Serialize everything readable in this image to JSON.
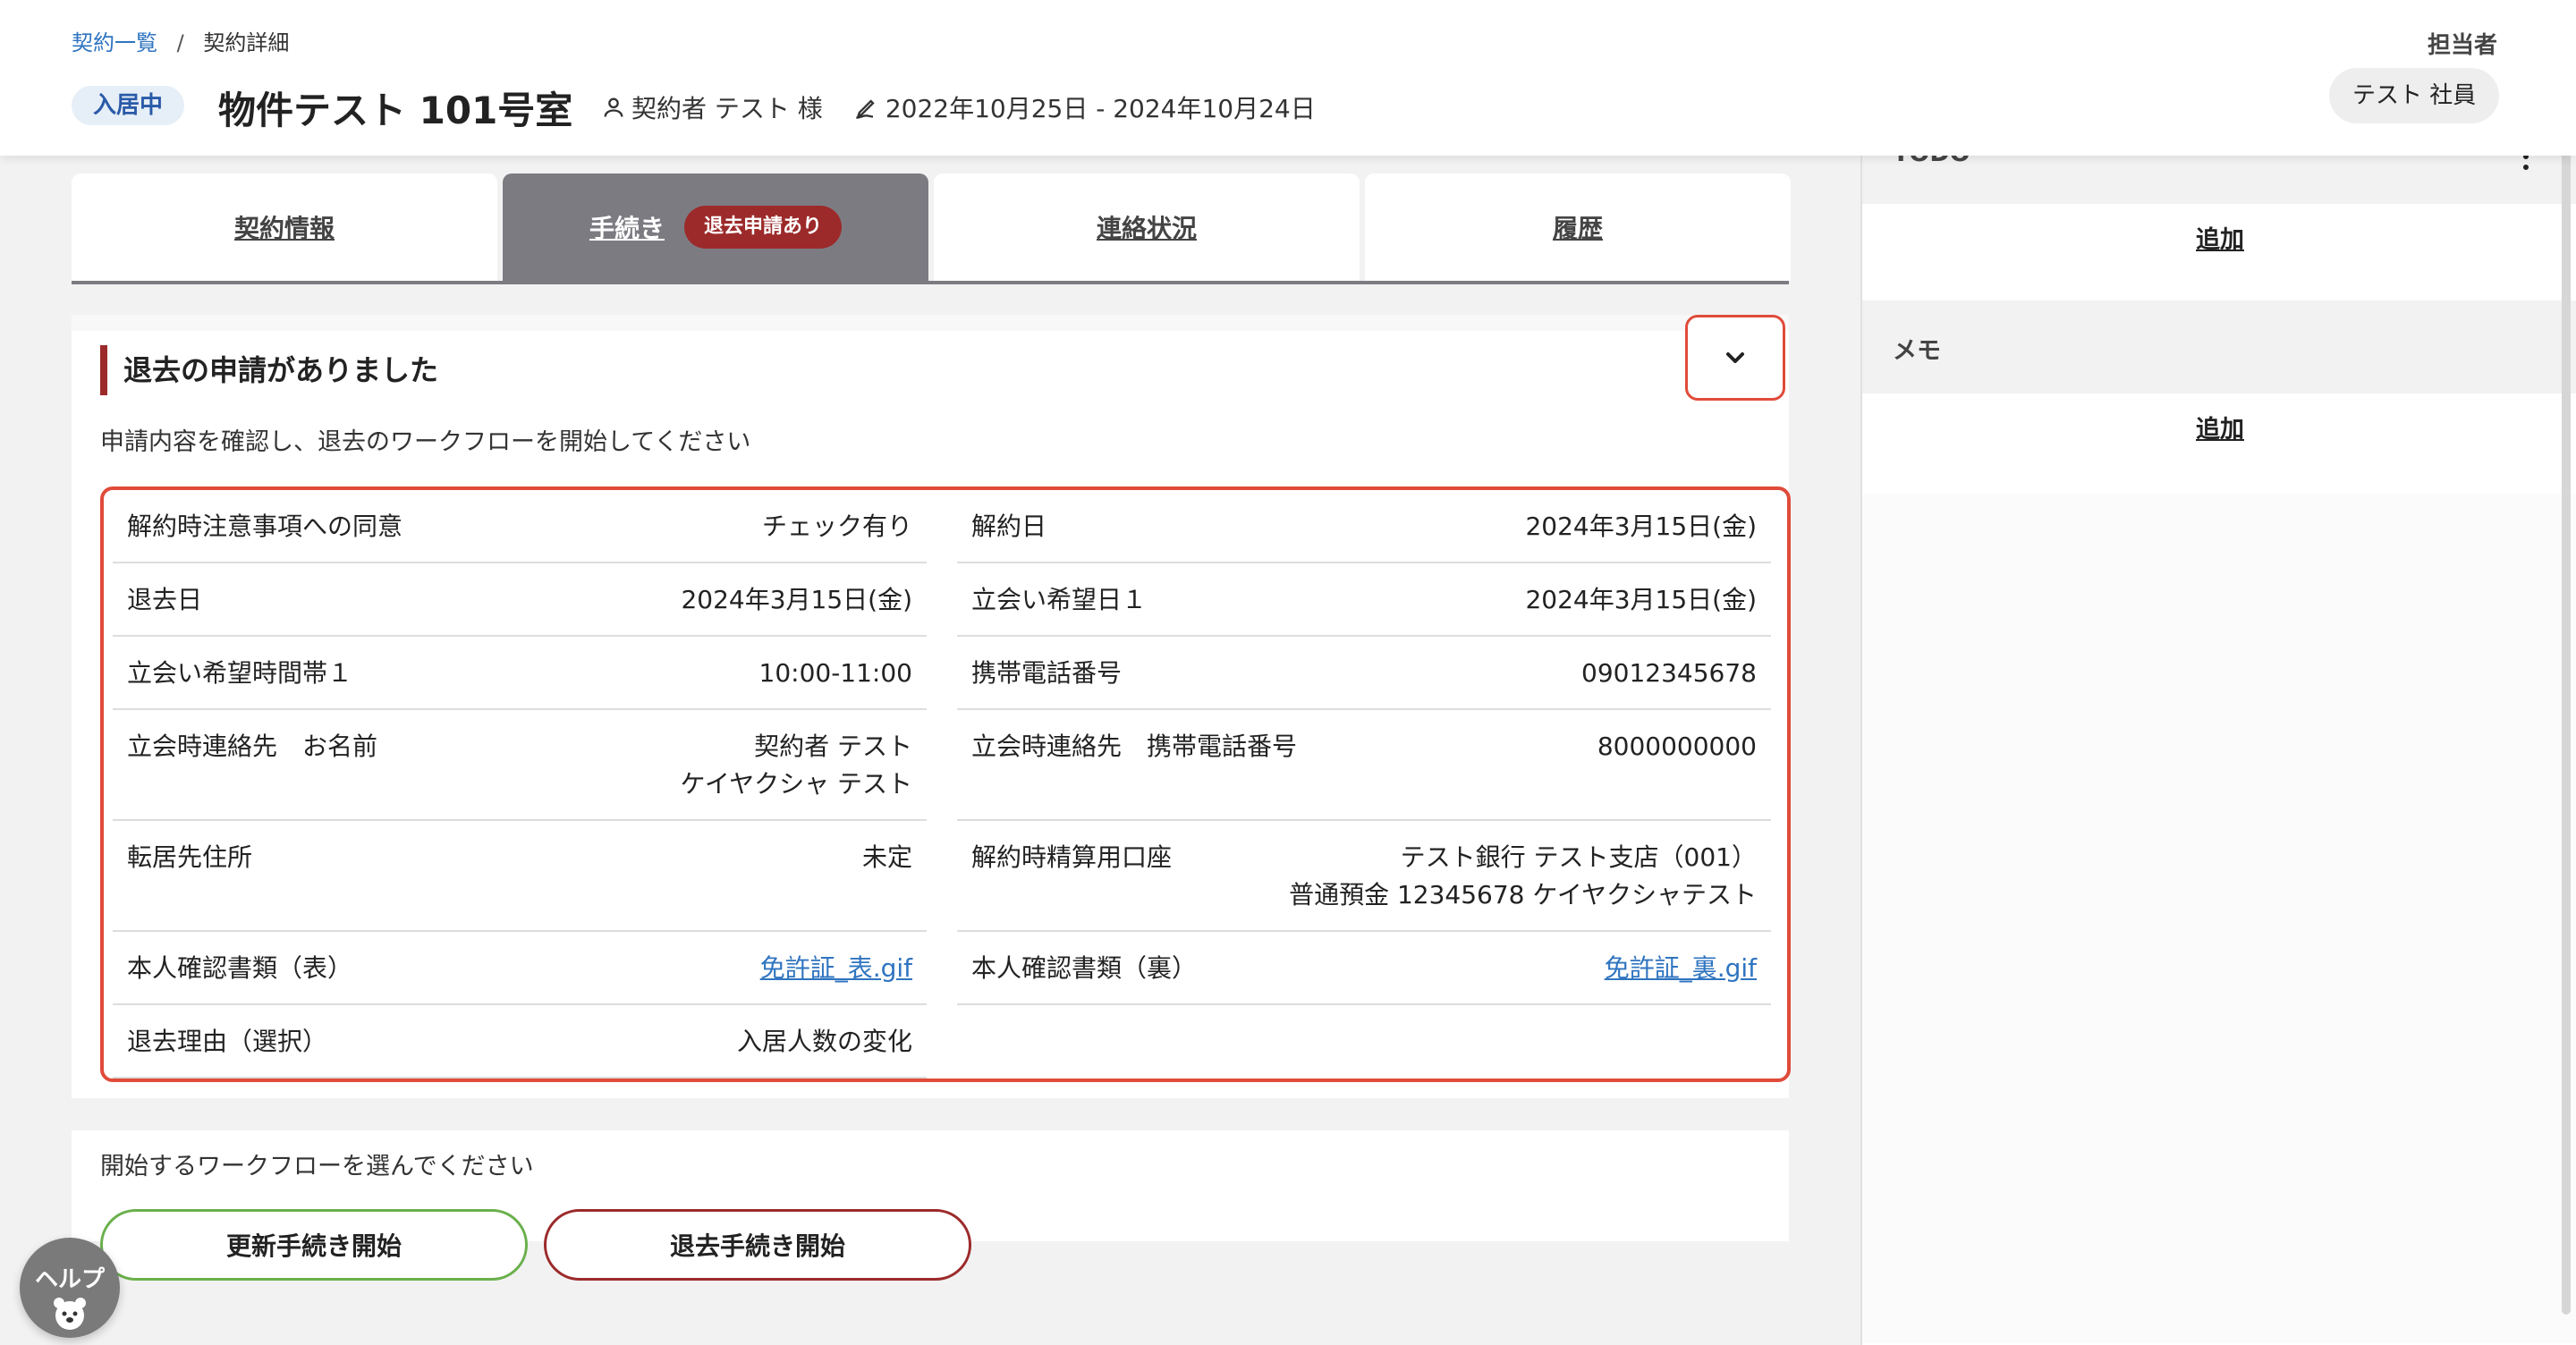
{
  "breadcrumb": {
    "parent": "契約一覧",
    "separator": "/",
    "current": "契約詳細"
  },
  "header": {
    "status": "入居中",
    "title": "物件テスト 101号室",
    "contractor": "契約者 テスト 様",
    "period": "2022年10月25日 - 2024年10月24日",
    "assignee_label": "担当者",
    "assignee_name": "テスト 社員"
  },
  "tabs": [
    {
      "label": "契約情報"
    },
    {
      "label": "手続き",
      "badge": "退去申請あり",
      "active": true
    },
    {
      "label": "連絡状況"
    },
    {
      "label": "履歴"
    }
  ],
  "request": {
    "title": "退去の申請がありました",
    "instruction": "申請内容を確認し、退去のワークフローを開始してください",
    "left": [
      {
        "key": "解約時注意事項への同意",
        "value": "チェック有り"
      },
      {
        "key": "退去日",
        "value": "2024年3月15日(金)"
      },
      {
        "key": "立会い希望時間帯１",
        "value": "10:00-11:00"
      },
      {
        "key": "立会時連絡先　お名前",
        "value": "契約者 テスト\nケイヤクシャ テスト"
      },
      {
        "key": "転居先住所",
        "value": "未定"
      },
      {
        "key": "本人確認書類（表）",
        "value": "免許証_表.gif"
      },
      {
        "key": "退去理由（選択）",
        "value": "入居人数の変化"
      }
    ],
    "right": [
      {
        "key": "解約日",
        "value": "2024年3月15日(金)"
      },
      {
        "key": "立会い希望日１",
        "value": "2024年3月15日(金)"
      },
      {
        "key": "携帯電話番号",
        "value": "09012345678"
      },
      {
        "key": "立会時連絡先　携帯電話番号",
        "value": "8000000000"
      },
      {
        "key": "解約時精算用口座",
        "value": "テスト銀行 テスト支店（001）\n普通預金 12345678 ケイヤクシャテスト"
      },
      {
        "key": "本人確認書類（裏）",
        "value": "免許証_裏.gif"
      }
    ]
  },
  "workflow": {
    "label": "開始するワークフローを選んでください",
    "renew_button": "更新手続き開始",
    "leave_button": "退去手続き開始"
  },
  "sidebar": {
    "todo_title": "TODO",
    "todo_add": "追加",
    "memo_title": "メモ",
    "memo_add": "追加"
  },
  "help": {
    "label": "ヘルプ"
  },
  "colors": {
    "accent_red": "#9c2a2a",
    "highlight_border": "#e04b3a",
    "link_blue": "#2f74c0",
    "renew_green": "#6ab04c",
    "active_tab": "#7d7b82"
  }
}
